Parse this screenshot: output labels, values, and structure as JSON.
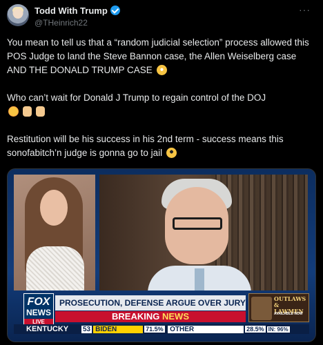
{
  "author": {
    "display_name": "Todd With Trump",
    "handle": "@THeinrich22",
    "verified": true
  },
  "more_icon": "···",
  "tweet": {
    "paragraphs": [
      "You mean to tell us that a “random judicial selection” process allowed this POS Judge to land the Steve Bannon case, the Allen Weiselberg case AND THE DONALD TRUMP CASE",
      "Who can’t wait for Donald J Trump to regain control of the DOJ",
      "Restitution will be his success in his 2nd term - success means this sonofabitch’n judge is gonna go to jail"
    ],
    "emojis": [
      "face-screaming-icon",
      "flushed-face-icon",
      "facepalm-icon",
      "facepalm-icon",
      "sunglasses-face-icon"
    ]
  },
  "media": {
    "network": {
      "fox": "FOX",
      "news": "NEWS",
      "live": "LIVE"
    },
    "headline": "PROSECUTION, DEFENSE ARGUE OVER JURY INSTRUCTIONS",
    "breaking": {
      "word1": "BREAKING",
      "word2": "NEWS"
    },
    "promo": {
      "title": "OUTLAWS & LAWMEN",
      "availability": "AVAILABLE NOW"
    },
    "ticker": {
      "state": "KENTUCKY",
      "number": "53",
      "candidate": "BIDEN",
      "candidate_pct": "71.5%",
      "other": "OTHER",
      "other_pct": "28.5%",
      "reporting": "IN: 96%"
    }
  }
}
